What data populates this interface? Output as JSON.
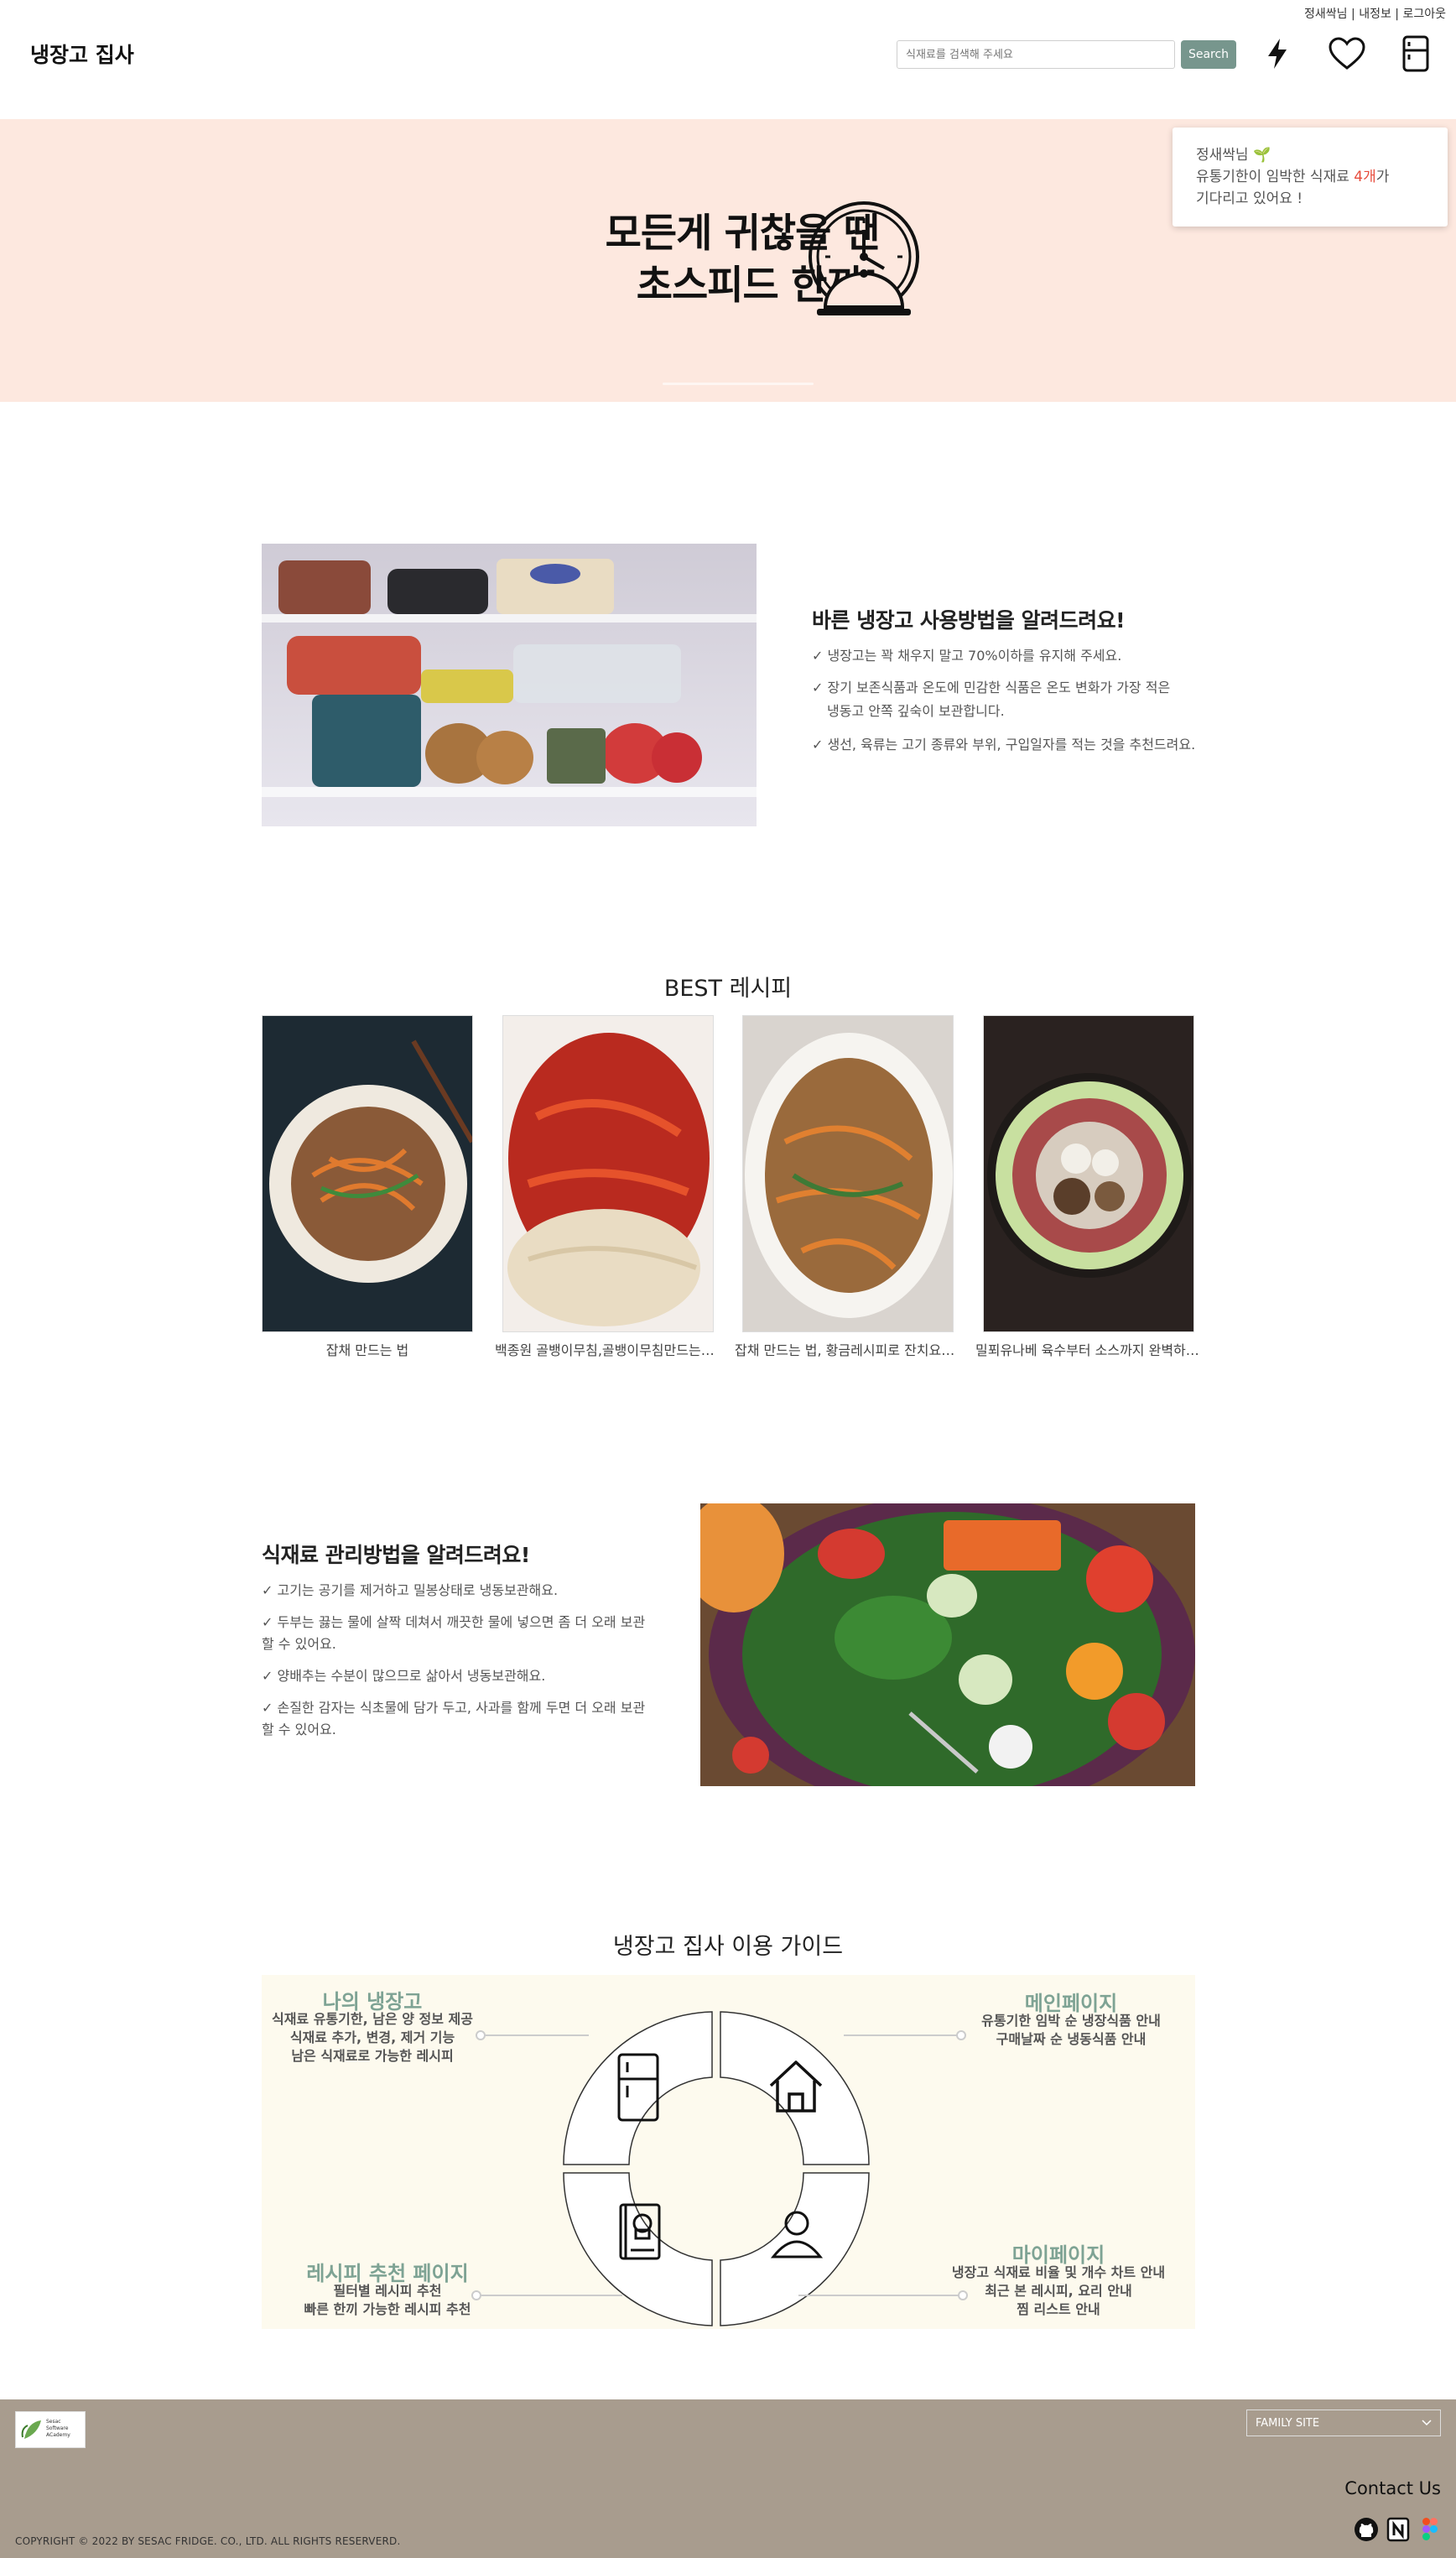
{
  "header": {
    "user_links": [
      "정새싹님",
      "내정보",
      "로그아웃"
    ],
    "brand": "냉장고 집사",
    "search_placeholder": "식재료를 검색해 주세요",
    "search_button": "Search",
    "icons": [
      "lightning-icon",
      "heart-icon",
      "fridge-icon"
    ]
  },
  "hero": {
    "title_line1": "모든게 귀찮을 땐",
    "title_line2": "초스피드 한끼!",
    "icon": "cloche-clock-icon"
  },
  "toast": {
    "greeting": "정새싹님 🌱",
    "line1_prefix": "유통기한이 임박한 식재료 ",
    "count": "4개",
    "line1_suffix": "가",
    "line2": "기다리고 있어요 !",
    "count_color": "#e74c3c"
  },
  "fridge_tips": {
    "title": "바른 냉장고 사용방법을 알려드려요!",
    "items": [
      "✓ 냉장고는 꽉 채우지 말고 70%이하를 유지해 주세요.",
      "✓ 장기 보존식품과 온도에 민감한 식품은 온도 변화가 가장 적은",
      "냉동고 안쪽 깊숙이 보관합니다.",
      "✓ 생선, 육류는 고기 종류와 부위, 구입일자를 적는 것을 추천드려요."
    ]
  },
  "best_recipes": {
    "title": "BEST 레시피",
    "items": [
      {
        "caption": "잡채 만드는 법"
      },
      {
        "caption": "백종원 골뱅이무침,골뱅이무침만드는법,골뱅이소면"
      },
      {
        "caption": "잡채 만드는 법, 황금레시피로 잔치요리 완성"
      },
      {
        "caption": "밀푀유나베 육수부터 소스까지 완벽하게 만들기"
      }
    ]
  },
  "ingredient_tips": {
    "title": "식재료 관리방법을 알려드려요!",
    "items": [
      "✓ 고기는 공기를 제거하고 밀봉상태로 냉동보관해요.",
      "✓ 두부는 끓는 물에 살짝 데쳐서 깨끗한 물에 넣으면 좀 더 오래 보관",
      "할 수 있어요.",
      "✓ 양배추는 수분이 많으므로 삶아서 냉동보관해요.",
      "✓ 손질한 감자는 식초물에 담가 두고, 사과를 함께 두면 더 오래 보관",
      "할 수 있어요."
    ]
  },
  "guide": {
    "title": "냉장고 집사 이용 가이드",
    "sections": [
      {
        "title": "나의 냉장고",
        "lines": [
          "식재료 유통기한, 남은 양 정보 제공",
          "식재료 추가, 변경, 제거 기능",
          "남은 식재료로 가능한 레시피"
        ],
        "icon": "fridge-icon"
      },
      {
        "title": "메인페이지",
        "lines": [
          "유통기한 임박 순 냉장식품 안내",
          "구매날짜 순 냉동식품 안내"
        ],
        "icon": "home-icon"
      },
      {
        "title": "레시피 추천 페이지",
        "lines": [
          "필터별 레시피 추천",
          "빠른 한끼 가능한 레시피 추천"
        ],
        "icon": "recipe-book-icon"
      },
      {
        "title": "마이페이지",
        "lines": [
          "냉장고 식재료 비율 및 개수 차트 안내",
          "최근 본 레시피, 요리 안내",
          "찜 리스트 안내"
        ],
        "icon": "user-icon"
      }
    ]
  },
  "footer": {
    "logo_text": [
      "Sesac",
      "Software",
      "ACademy"
    ],
    "family_site": "FAMILY SITE",
    "contact": "Contact Us",
    "copyright": "COPYRIGHT © 2022 BY SESAC FRIDGE. CO., LTD. ALL RIGHTS RESERVERD.",
    "icons": [
      "github-icon",
      "notion-icon",
      "figma-icon"
    ]
  },
  "colors": {
    "hero_bg": "#fde8df",
    "accent_green": "#77968d",
    "guide_heading": "#7ea394",
    "guide_bg": "#fdfaee",
    "footer_bg": "#a89c8e"
  }
}
